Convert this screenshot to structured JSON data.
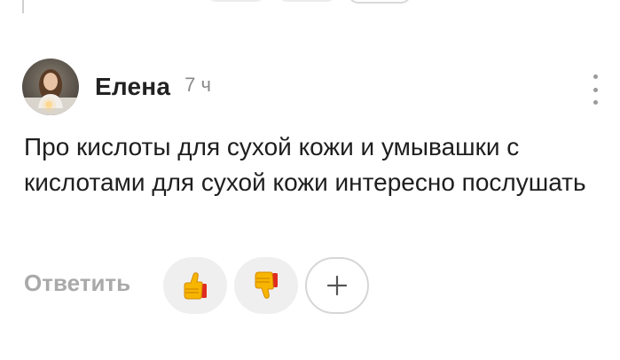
{
  "comment": {
    "author": "Елена",
    "time": "7 ч",
    "text": "Про кислоты для сухой кожи и умывашки с кислотами для сухой кожи интересно послушать",
    "reply_label": "Ответить"
  },
  "icons": {
    "more": "more-vertical-icon",
    "like": "thumbs-up-icon",
    "dislike": "thumbs-down-icon",
    "add": "plus-icon"
  },
  "colors": {
    "author": "#222222",
    "time": "#8a8a8a",
    "text": "#1e1e1e",
    "reply": "#a9a9a9",
    "reaction_bg": "#efefef",
    "emoji_yellow": "#f7b500",
    "emoji_red": "#e02b20"
  }
}
